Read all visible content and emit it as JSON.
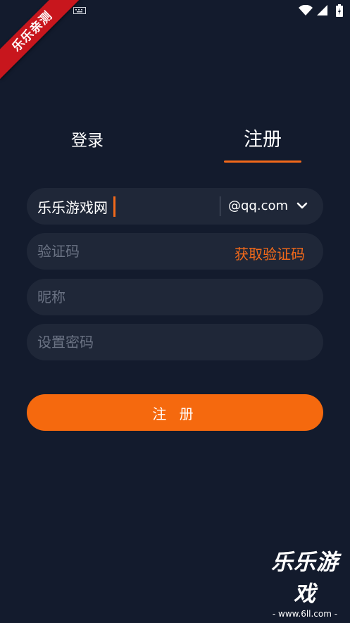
{
  "ribbon": {
    "text": "乐乐亲测"
  },
  "tabs": [
    {
      "label": "登录",
      "active": false
    },
    {
      "label": "注册",
      "active": true
    }
  ],
  "form": {
    "account": {
      "value": "乐乐游戏网",
      "placeholder": ""
    },
    "email_domain": {
      "selected": "@qq.com"
    },
    "code": {
      "placeholder": "验证码",
      "get_code_label": "获取验证码"
    },
    "nickname": {
      "placeholder": "昵称"
    },
    "password": {
      "placeholder": "设置密码"
    },
    "submit_label": "注 册"
  },
  "watermark": {
    "title": "乐乐游戏",
    "url": "- www.6ll.com -"
  },
  "colors": {
    "background": "#131b2d",
    "field": "#1f2738",
    "accent": "#f5690e"
  },
  "icons": [
    "image-icon",
    "keyboard-icon",
    "wifi-icon",
    "signal-icon",
    "battery-icon",
    "chevron-down-icon"
  ]
}
